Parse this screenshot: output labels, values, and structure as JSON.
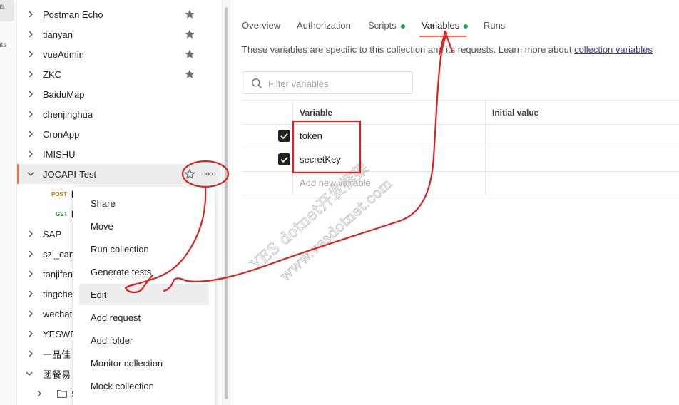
{
  "rail": {
    "labels": [
      "ns",
      "nts"
    ]
  },
  "sidebar": {
    "items": [
      {
        "label": "Postman Echo",
        "starred": true
      },
      {
        "label": "tianyan",
        "starred": true
      },
      {
        "label": "vueAdmin",
        "starred": true
      },
      {
        "label": "ZKC",
        "starred": true
      },
      {
        "label": "BaiduMap"
      },
      {
        "label": "chenjinghua"
      },
      {
        "label": "CronApp"
      },
      {
        "label": "IMISHU"
      },
      {
        "label": "JOCAPI-Test",
        "expanded": true,
        "selected": true
      },
      {
        "label": "SAP"
      },
      {
        "label": "szl_cart"
      },
      {
        "label": "tanjifen"
      },
      {
        "label": "tingche"
      },
      {
        "label": "wechat"
      },
      {
        "label": "YESWE"
      },
      {
        "label": "一品佳"
      },
      {
        "label": "团餐易",
        "expanded": true
      }
    ],
    "requests": [
      {
        "method": "POST",
        "name": "l"
      },
      {
        "method": "GET",
        "name": "l"
      }
    ],
    "subfolder": {
      "name": "S"
    }
  },
  "context_menu": {
    "items": [
      "Share",
      "Move",
      "Run collection",
      "Generate tests",
      "Edit",
      "Add request",
      "Add folder",
      "Monitor collection",
      "Mock collection"
    ],
    "hovered": "Edit"
  },
  "main": {
    "tabs": [
      {
        "label": "Overview"
      },
      {
        "label": "Authorization"
      },
      {
        "label": "Scripts",
        "dot": true
      },
      {
        "label": "Variables",
        "dot": true,
        "active": true
      },
      {
        "label": "Runs"
      }
    ],
    "description": "These variables are specific to this collection and its requests. Learn more about ",
    "description_link": "collection variables",
    "filter_placeholder": "Filter variables",
    "table": {
      "headers": [
        "Variable",
        "Initial value"
      ],
      "rows": [
        {
          "checked": true,
          "variable": "token",
          "initial": ""
        },
        {
          "checked": true,
          "variable": "secretKey",
          "initial": ""
        }
      ],
      "add_placeholder": "Add new variable"
    }
  },
  "watermark": {
    "line1": "YES dotnet开发框架",
    "line2": "www.vesdotnet.com"
  },
  "colors": {
    "accent": "#ff6c37",
    "success_dot": "#29a745",
    "annotation": "#e02020"
  }
}
